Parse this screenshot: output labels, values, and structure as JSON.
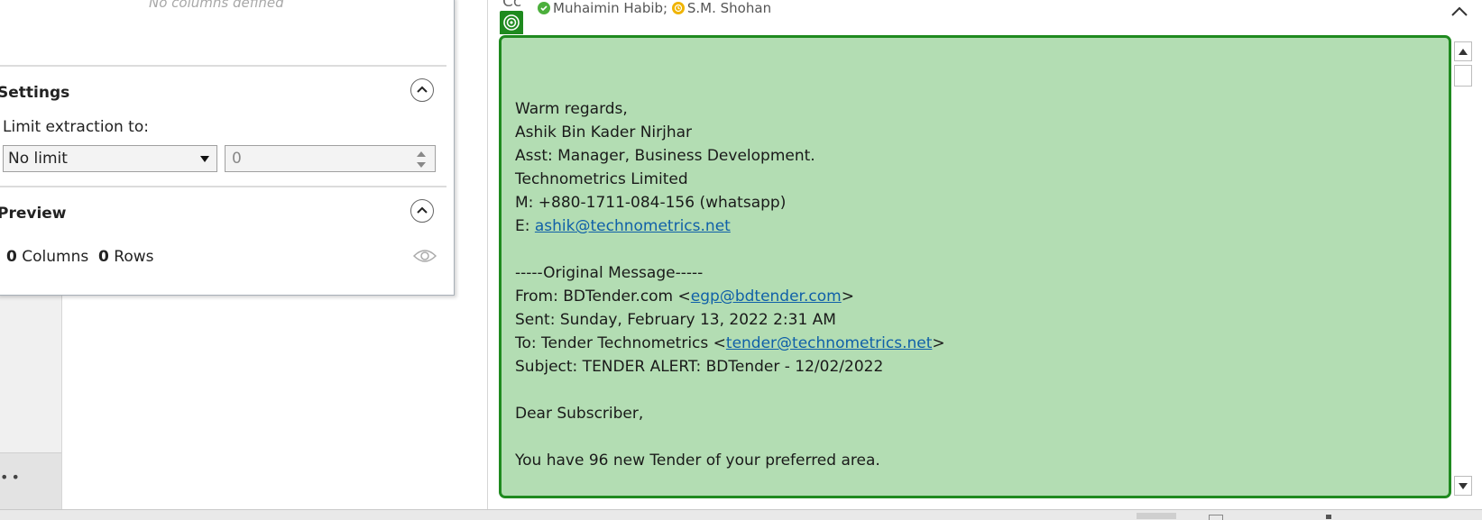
{
  "panel": {
    "columns_placeholder": "No columns defined",
    "settings_title": "Settings",
    "limit_label": "Limit extraction to:",
    "limit_select_value": "No limit",
    "limit_number_value": "0",
    "preview_title": "Preview",
    "columns_count": "0",
    "columns_label": "Columns",
    "rows_count": "0",
    "rows_label": "Rows"
  },
  "email": {
    "cc_label": "Cc",
    "recipients": [
      {
        "name": "Muhaimin Habib;",
        "status": "available",
        "color": "#4caf3c"
      },
      {
        "name": "S.M. Shohan",
        "status": "away",
        "color": "#f0b400"
      }
    ],
    "body": {
      "closing": "Warm regards,",
      "sender_name": "Ashik Bin Kader Nirjhar",
      "sender_title": "Asst: Manager, Business Development.",
      "sender_company": "Technometrics Limited",
      "sender_mobile": "M: +880-1711-084-156 (whatsapp)",
      "sender_email_prefix": "E: ",
      "sender_email": "ashik@technometrics.net",
      "original_header": "-----Original Message-----",
      "from_prefix": "From: BDTender.com <",
      "from_email": "egp@bdtender.com",
      "from_suffix": ">",
      "sent": "Sent: Sunday, February 13, 2022 2:31 AM",
      "to_prefix": "To: Tender Technometrics <",
      "to_email": "tender@technometrics.net",
      "to_suffix": ">",
      "subject": "Subject: TENDER ALERT: BDTender - 12/02/2022",
      "greeting": "Dear Subscriber,",
      "message": "You have 96 new Tender of your preferred area."
    }
  },
  "colors": {
    "highlight_fill": "#b3ddb3",
    "highlight_border": "#1f8a1f",
    "link": "#1060a8"
  }
}
